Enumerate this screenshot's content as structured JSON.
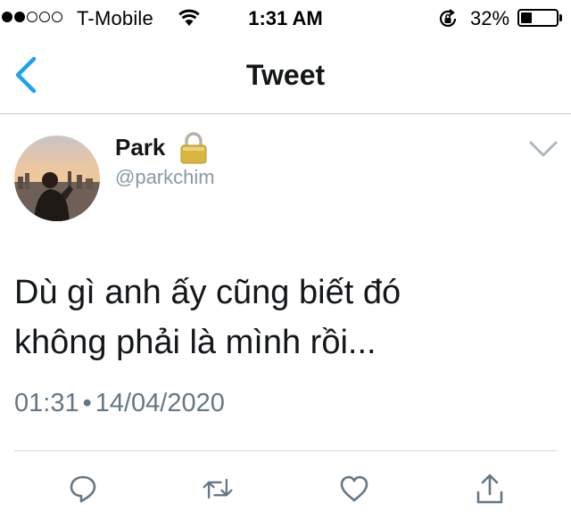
{
  "status_bar": {
    "carrier": "T-Mobile",
    "time": "1:31 AM",
    "battery_percent": "32%",
    "battery_level": 0.32,
    "signal_bars_filled": 2,
    "signal_bars_total": 5
  },
  "nav": {
    "title": "Tweet",
    "back_icon": "chevron-left-icon",
    "accent_color": "#1da1f2"
  },
  "tweet": {
    "display_name": "Park",
    "handle": "@parkchim",
    "protected_icon": "lock-icon",
    "text": "Dù gì anh ấy cũng biết đó\nkhông phải là mình rồi...",
    "time": "01:31",
    "separator": "•",
    "date": "14/04/2020"
  },
  "actions": {
    "reply_icon": "reply-icon",
    "retweet_icon": "retweet-icon",
    "like_icon": "heart-icon",
    "share_icon": "share-icon",
    "icon_color": "#657786"
  }
}
